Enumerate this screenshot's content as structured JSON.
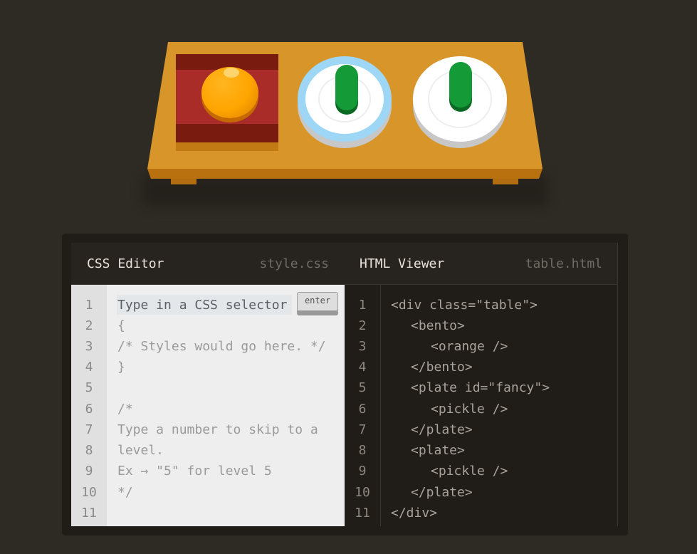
{
  "css_editor": {
    "title": "CSS Editor",
    "filename": "style.css",
    "input_placeholder": "Type in a CSS selector",
    "enter_label": "enter",
    "line_numbers": [
      "1",
      "2",
      "3",
      "4",
      "5",
      "6",
      "7",
      "8",
      "9",
      "10",
      "11"
    ],
    "lines": [
      "",
      "{",
      "/* Styles would go here. */",
      "}",
      "",
      "/*",
      "Type a number to skip to a",
      "level.",
      "Ex → \"5\" for level 5",
      "*/",
      ""
    ]
  },
  "html_viewer": {
    "title": "HTML Viewer",
    "filename": "table.html",
    "line_numbers": [
      "1",
      "2",
      "3",
      "4",
      "5",
      "6",
      "7",
      "8",
      "9",
      "10",
      "11"
    ],
    "lines": [
      "<div class=\"table\">",
      "<bento>",
      "<orange />",
      "</bento>",
      "<plate id=\"fancy\">",
      "<pickle />",
      "</plate>",
      "<plate>",
      "<pickle />",
      "</plate>",
      "</div>"
    ],
    "indent_levels": [
      0,
      1,
      2,
      1,
      1,
      2,
      1,
      1,
      2,
      1,
      0
    ]
  },
  "colors": {
    "background": "#2e2a24",
    "table": "#d8962a",
    "bento": "#a92c28",
    "orange": "#ffa500",
    "fancy_plate_rim": "#9dd7f5",
    "pickle": "#159a38"
  }
}
